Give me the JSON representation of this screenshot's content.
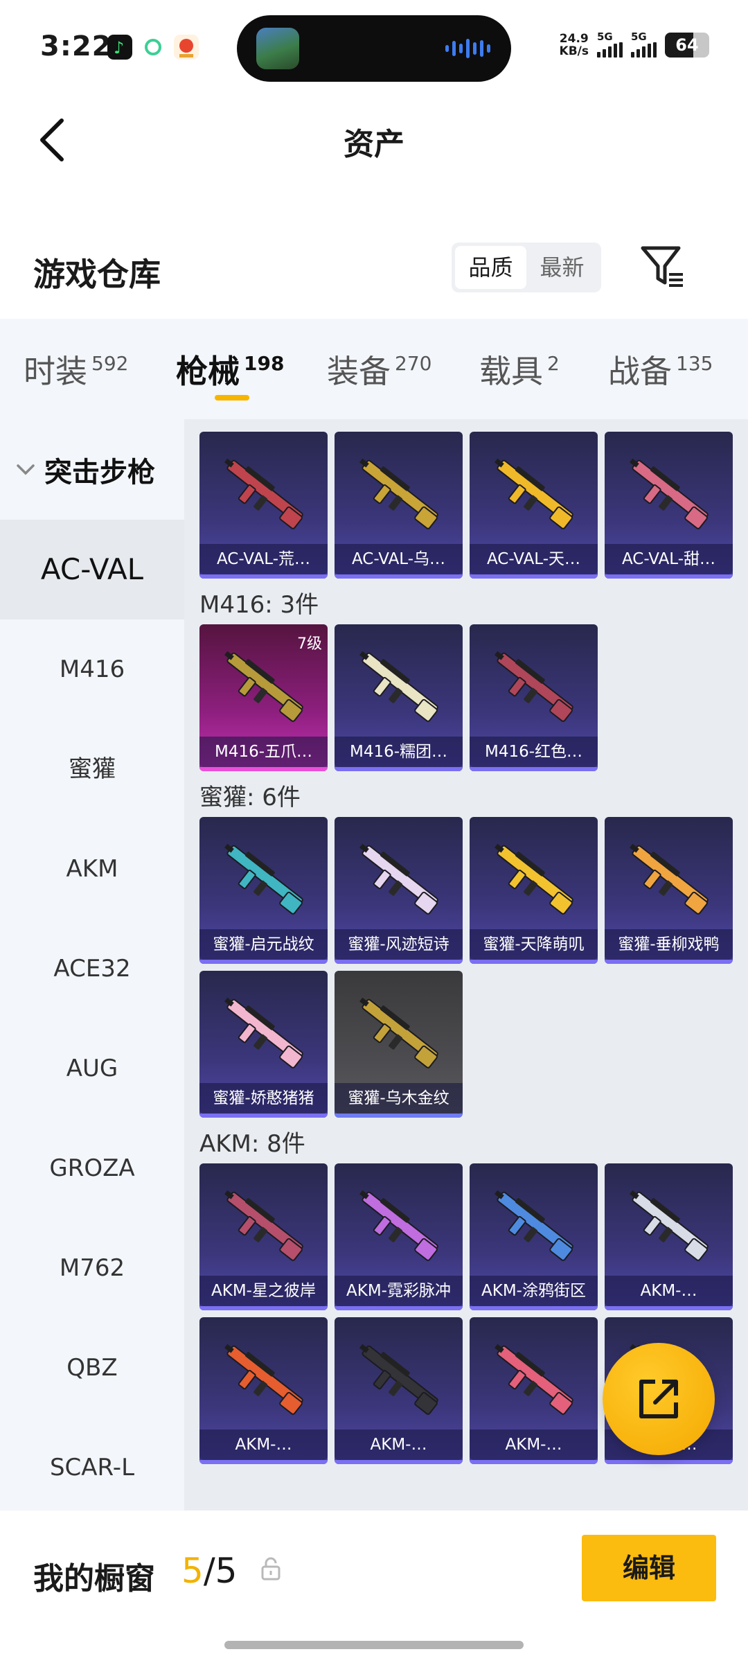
{
  "status_bar": {
    "time": "3:22",
    "net_speed_value": "24.9",
    "net_speed_unit": "KB/s",
    "signal1_label": "5G",
    "signal2_label": "5G",
    "battery": "64",
    "battery_level": 0.64
  },
  "header": {
    "title": "资产",
    "back_icon": "chevron-left-icon"
  },
  "warehouse": {
    "title": "游戏仓库",
    "sort_options": [
      "品质",
      "最新"
    ],
    "sort_selected": "品质",
    "filter_icon": "filter-icon"
  },
  "category_tabs": [
    {
      "label": "时装",
      "count": "592"
    },
    {
      "label": "枪械",
      "count": "198",
      "active": true
    },
    {
      "label": "装备",
      "count": "270"
    },
    {
      "label": "载具",
      "count": "2"
    },
    {
      "label": "战备",
      "count": "135"
    }
  ],
  "sidebar": {
    "group": "突击步枪",
    "items": [
      "AC-VAL",
      "M416",
      "蜜獾",
      "AKM",
      "ACE32",
      "AUG",
      "GROZA",
      "M762",
      "QBZ",
      "SCAR-L"
    ],
    "active": "AC-VAL"
  },
  "sections": [
    {
      "heading": "",
      "items": [
        {
          "label": "AC-VAL-荒…",
          "color": "#c0444d"
        },
        {
          "label": "AC-VAL-乌…",
          "color": "#c9a437"
        },
        {
          "label": "AC-VAL-天…",
          "color": "#f0b92a"
        },
        {
          "label": "AC-VAL-甜…",
          "color": "#d86a85"
        }
      ]
    },
    {
      "heading": "M416: 3件",
      "items": [
        {
          "label": "M416-五爪…",
          "badge": "7级",
          "tier": "red",
          "color": "#b79a3a"
        },
        {
          "label": "M416-糯团…",
          "color": "#e8e4c4"
        },
        {
          "label": "M416-红色…",
          "color": "#b0465a"
        }
      ]
    },
    {
      "heading": "蜜獾: 6件",
      "items": [
        {
          "label": "蜜獾-启元战纹",
          "color": "#3fb6c2"
        },
        {
          "label": "蜜獾-风迹短诗",
          "color": "#e6d6ef"
        },
        {
          "label": "蜜獾-天降萌叽",
          "color": "#f2c32f"
        },
        {
          "label": "蜜獾-垂柳戏鸭",
          "color": "#f0a540"
        },
        {
          "label": "蜜獾-娇憨猪猪",
          "color": "#f3b6cf"
        },
        {
          "label": "蜜獾-乌木金纹",
          "tier": "gray",
          "color": "#c4a23a"
        }
      ]
    },
    {
      "heading": "AKM: 8件",
      "items": [
        {
          "label": "AKM-星之彼岸",
          "color": "#b54f6c"
        },
        {
          "label": "AKM-霓彩脉冲",
          "color": "#c06de0"
        },
        {
          "label": "AKM-涂鸦街区",
          "color": "#4e8be0"
        },
        {
          "label": "AKM-…",
          "color": "#d8dce6"
        },
        {
          "label": "AKM-…",
          "color": "#e65d2f"
        },
        {
          "label": "AKM-…",
          "color": "#333338"
        },
        {
          "label": "AKM-…",
          "color": "#e5607a"
        },
        {
          "label": "AKM-…",
          "color": "#c0444d"
        }
      ]
    }
  ],
  "bottom_bar": {
    "title": "我的橱窗",
    "count_current": "5",
    "count_sep": "/",
    "count_total": "5",
    "edit_label": "编辑"
  }
}
